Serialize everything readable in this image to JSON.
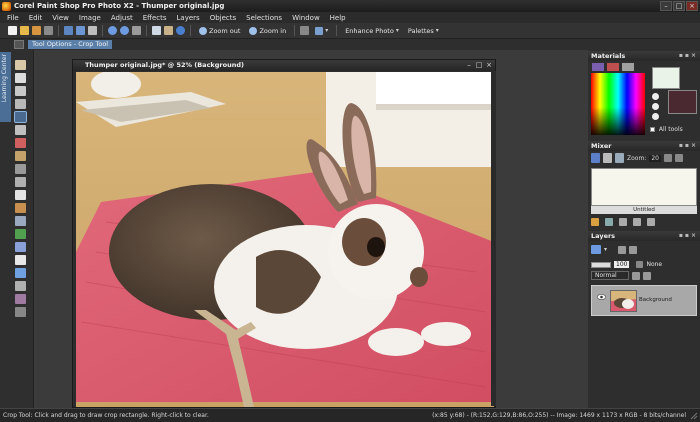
{
  "window": {
    "title": "Corel Paint Shop Pro Photo X2 - Thumper original.jpg",
    "min_label": "–",
    "max_label": "□",
    "close_label": "×"
  },
  "menu": [
    "File",
    "Edit",
    "View",
    "Image",
    "Adjust",
    "Effects",
    "Layers",
    "Objects",
    "Selections",
    "Window",
    "Help"
  ],
  "toolbar": {
    "zoom_out_label": "Zoom out",
    "zoom_in_label": "Zoom in",
    "enhance_photo_label": "Enhance Photo",
    "palettes_label": "Palettes"
  },
  "tool_options": {
    "tab_label": "Tool Options - Crop Tool",
    "learning_center_label": "Learning Center"
  },
  "document": {
    "title": "Thumper original.jpg* @ 52% (Background)",
    "min_label": "–",
    "max_label": "□",
    "close_label": "×"
  },
  "materials": {
    "header": "Materials",
    "all_tools_label": "All tools",
    "foreground_color": "#eaf3e8",
    "background_color": "#4a2a30"
  },
  "mixer": {
    "header": "Mixer",
    "zoom_label": "Zoom:",
    "zoom_value": "20",
    "caption": "Untitled"
  },
  "layers": {
    "header": "Layers",
    "opacity_value": "100",
    "mask_label": "None",
    "blend_mode": "Normal",
    "layer_name": "Background"
  },
  "status": {
    "left": "Crop Tool: Click and drag to draw crop rectangle. Right-click to clear.",
    "right": "(x:85 y:68) - (R:152,G:129,B:86,O:255) -- Image:  1469 x 1173 x RGB - 8 bits/channel"
  }
}
